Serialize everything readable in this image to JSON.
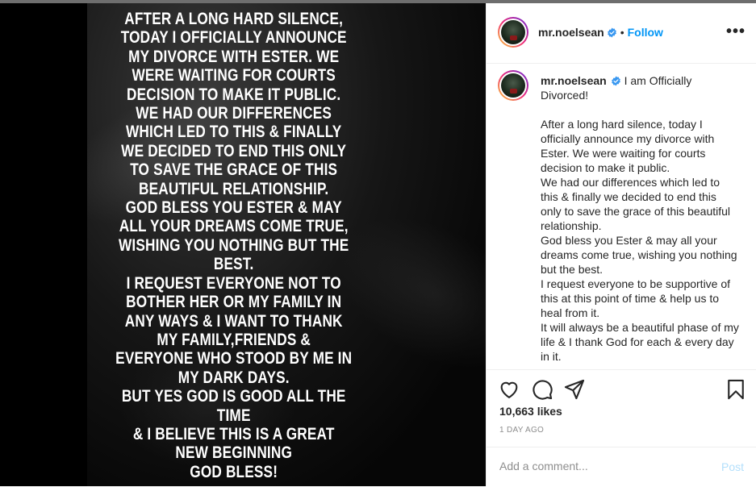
{
  "post": {
    "username": "mr.noelsean",
    "follow_label": "Follow",
    "separator": "•",
    "more_label": "•••",
    "image_text_lines": [
      "AFTER A LONG HARD SILENCE,",
      "TODAY I OFFICIALLY ANNOUNCE",
      "MY DIVORCE WITH ESTER. WE",
      "WERE WAITING FOR COURTS",
      "DECISION TO MAKE IT PUBLIC.",
      "WE HAD OUR DIFFERENCES",
      "WHICH LED TO THIS &  FINALLY",
      "WE DECIDED TO END THIS ONLY",
      "TO SAVE THE GRACE OF THIS",
      "BEAUTIFUL RELATIONSHIP.",
      "GOD BLESS YOU ESTER & MAY",
      "ALL YOUR DREAMS COME TRUE,",
      "WISHING YOU NOTHING BUT THE",
      "BEST.",
      "I REQUEST EVERYONE NOT TO",
      "BOTHER HER OR MY FAMILY IN",
      "ANY WAYS & I WANT TO THANK",
      "MY FAMILY,FRIENDS &",
      "EVERYONE WHO STOOD BY ME IN",
      "MY DARK DAYS.",
      "BUT YES GOD IS GOOD ALL THE",
      "TIME",
      "& I BELIEVE THIS IS A GREAT",
      "NEW BEGINNING",
      "GOD BLESS!"
    ],
    "caption_title": "I am Officially Divorced!",
    "caption_body": "After a long hard silence, today I officially announce my divorce with Ester. We were waiting for courts decision to make it public.\nWe had our differences which led to this & finally we decided to end this only to save the grace of this beautiful relationship.\nGod bless you Ester & may all your dreams come true, wishing you nothing but the best.\nI request everyone to be supportive of this at this point of time & help us to heal from it.\nIt will always be a beautiful phase of my life & I thank God for each & every day in it.",
    "likes": "10,663 likes",
    "date": "1 DAY AGO",
    "comment_placeholder": "Add a comment...",
    "post_label": "Post"
  },
  "icons": {
    "like": "heart-icon",
    "comment": "comment-icon",
    "share": "share-icon",
    "save": "bookmark-icon",
    "verified": "verified-badge-icon"
  },
  "colors": {
    "accent": "#0095f6",
    "post_disabled": "#b2dffc",
    "text": "#262626",
    "muted": "#8e8e8e",
    "verified": "#3897f0"
  }
}
